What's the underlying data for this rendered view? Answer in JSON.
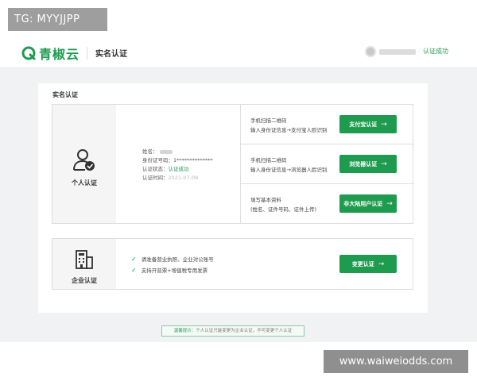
{
  "watermarks": {
    "top_left": "TG: MYYJJPP",
    "bottom_right": "www.waiweiodds.com"
  },
  "header": {
    "logo_text": "青椒云",
    "title": "实名认证",
    "user_status": "认证成功"
  },
  "card": {
    "title": "实名认证"
  },
  "personal": {
    "label": "个人认证",
    "info": {
      "name_label": "姓名：",
      "id_label": "身份证号码：",
      "id_value": "1**************",
      "status_label": "认证状态：",
      "status_value": "认证成功",
      "time_label": "认证时间：",
      "time_value": "2021-07-09"
    },
    "options": [
      {
        "line1": "手机扫描二维码",
        "line2": "输入身份证信息→支付宝人脸识别",
        "button": "支付宝认证"
      },
      {
        "line1": "手机扫描二维码",
        "line2": "输入身份证信息→浏览器人脸识别",
        "button": "浏览器认证"
      },
      {
        "line1": "填写基本资料",
        "line2": "(姓名、证件号码、证件上传)",
        "button": "非大陆用户认证"
      }
    ]
  },
  "enterprise": {
    "label": "企业认证",
    "items": [
      "请准备营业执照、企业对公账号",
      "支持开普票+增值税专用发票"
    ],
    "button": "变更认证"
  },
  "notice": {
    "label": "温馨提示：",
    "text": "个人认证只能变更为企业认证，不可变更个人认证"
  },
  "colors": {
    "brand": "#1f9b4f",
    "background": "#f0f2f3"
  }
}
